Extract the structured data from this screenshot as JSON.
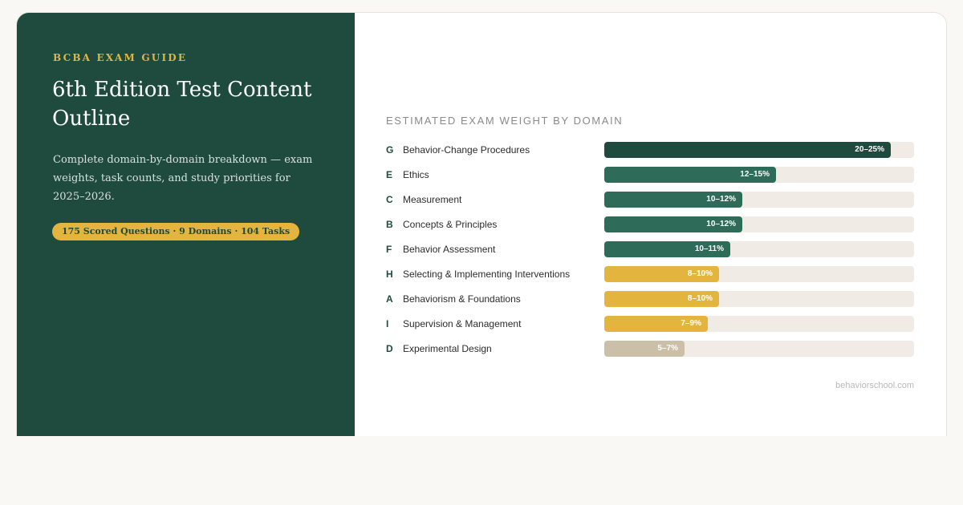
{
  "header": {
    "eyebrow": "BCBA EXAM GUIDE",
    "title": "6th Edition Test Content Outline",
    "subtitle": "Complete domain-by-domain breakdown — exam weights, task counts, and study priorities for 2025–2026.",
    "badge": "175 Scored Questions · 9 Domains · 104 Tasks"
  },
  "footer": {
    "site": "behaviorschool.com"
  },
  "colors": {
    "panel": "#1f4b3f",
    "accent": "#e4b53e",
    "top": "#1f4b3f",
    "high": "#2e6b58",
    "mid": "#e4b53e",
    "low": "#cbbfa8",
    "track": "#f0ece5"
  },
  "chart_data": {
    "type": "bar",
    "orientation": "horizontal",
    "title": "ESTIMATED EXAM WEIGHT BY DOMAIN",
    "xlim": [
      0,
      27
    ],
    "categories": [
      {
        "code": "G",
        "name": "Behavior-Change Procedures",
        "range": [
          20,
          25
        ],
        "label": "20–25%",
        "tier": "top"
      },
      {
        "code": "E",
        "name": "Ethics",
        "range": [
          12,
          15
        ],
        "label": "12–15%",
        "tier": "high"
      },
      {
        "code": "C",
        "name": "Measurement",
        "range": [
          10,
          12
        ],
        "label": "10–12%",
        "tier": "high"
      },
      {
        "code": "B",
        "name": "Concepts & Principles",
        "range": [
          10,
          12
        ],
        "label": "10–12%",
        "tier": "high"
      },
      {
        "code": "F",
        "name": "Behavior Assessment",
        "range": [
          10,
          11
        ],
        "label": "10–11%",
        "tier": "high"
      },
      {
        "code": "H",
        "name": "Selecting & Implementing Interventions",
        "range": [
          8,
          10
        ],
        "label": "8–10%",
        "tier": "mid"
      },
      {
        "code": "A",
        "name": "Behaviorism & Foundations",
        "range": [
          8,
          10
        ],
        "label": "8–10%",
        "tier": "mid"
      },
      {
        "code": "I",
        "name": "Supervision & Management",
        "range": [
          7,
          9
        ],
        "label": "7–9%",
        "tier": "mid"
      },
      {
        "code": "D",
        "name": "Experimental Design",
        "range": [
          5,
          7
        ],
        "label": "5–7%",
        "tier": "low"
      }
    ]
  }
}
